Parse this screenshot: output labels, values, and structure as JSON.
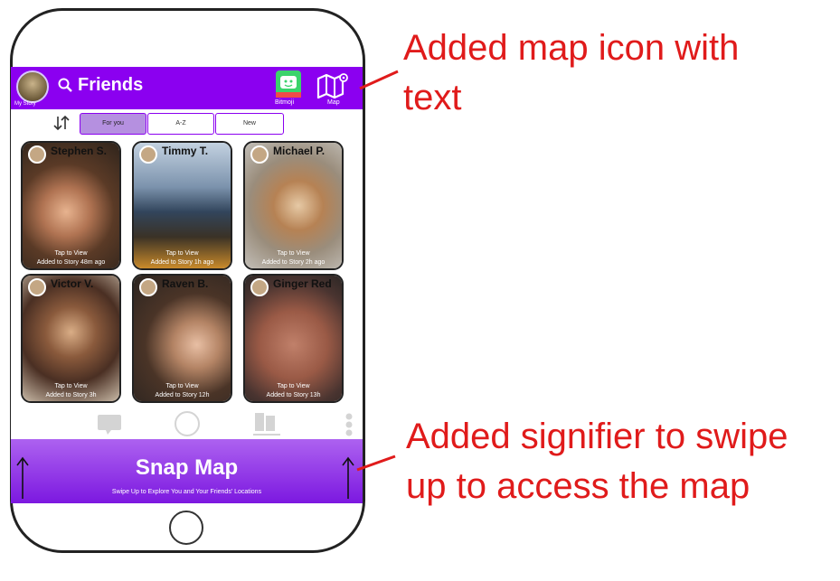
{
  "header": {
    "avatar_caption": "My Story",
    "title": "Friends",
    "bitmoji_caption": "Bitmoji",
    "map_caption": "Map"
  },
  "sort_tabs": [
    {
      "label": "For you",
      "active": true
    },
    {
      "label": "A-Z",
      "active": false
    },
    {
      "label": "New",
      "active": false
    }
  ],
  "cards": [
    {
      "name": "Stephen S.",
      "tap": "Tap to View",
      "added": "Added to Story 48m ago"
    },
    {
      "name": "Timmy T.",
      "tap": "Tap to View",
      "added": "Added to Story 1h ago"
    },
    {
      "name": "Michael P.",
      "tap": "Tap to View",
      "added": "Added to Story 2h ago"
    },
    {
      "name": "Victor V.",
      "tap": "Tap to View",
      "added": "Added to Story 3h"
    },
    {
      "name": "Raven B.",
      "tap": "Tap to View",
      "added": "Added to Story 12h"
    },
    {
      "name": "Ginger Red",
      "tap": "Tap to View",
      "added": "Added to Story 13h"
    }
  ],
  "bottom": {
    "title": "Snap Map",
    "subtitle": "Swipe Up to Explore You and Your Friends' Locations"
  },
  "annotations": {
    "top": [
      "Added map icon with",
      "text"
    ],
    "bottom": [
      "Added signifier to swipe",
      "up to access the map"
    ]
  },
  "colors": {
    "accent": "#8b00f0",
    "annotation": "#e01b1b"
  }
}
